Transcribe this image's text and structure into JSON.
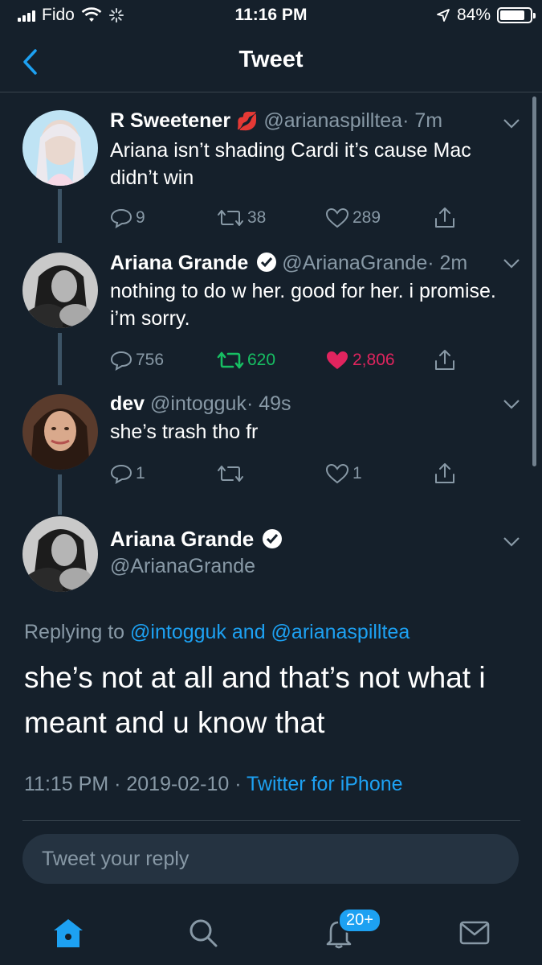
{
  "status_bar": {
    "carrier": "Fido",
    "time": "11:16 PM",
    "battery": "84%",
    "battery_level": 0.84
  },
  "nav": {
    "title": "Tweet"
  },
  "thread": [
    {
      "name": "R Sweetener",
      "emoji": "💋",
      "handle": "@arianaspilltea",
      "time": "· 7m",
      "text": "Ariana isn’t shading Cardi it’s cause Mac didn’t win",
      "replies": "9",
      "retweets": "38",
      "likes": "289"
    },
    {
      "name": "Ariana Grande",
      "handle": "@ArianaGrande",
      "time": "· 2m",
      "text": "nothing to do w her. good for her. i promise. i’m sorry.",
      "replies": "756",
      "retweets": "620",
      "likes": "2,806",
      "retweet_color": "#17bf63",
      "like_color": "#e0245e"
    },
    {
      "name": "dev",
      "handle": "@intogguk",
      "time": "· 49s",
      "text": "she’s trash tho fr",
      "replies": "1",
      "retweets": "",
      "likes": "1"
    }
  ],
  "main_tweet": {
    "name": "Ariana Grande",
    "handle": "@ArianaGrande",
    "replying_prefix": "Replying to ",
    "replying_user1": "@intogguk",
    "replying_and": " and ",
    "replying_user2": "@arianaspilltea",
    "text": "she’s not at all and that’s not what i meant and u know that",
    "timestamp": "11:15 PM · 2019-02-10 · ",
    "source": "Twitter for iPhone"
  },
  "reply_box": {
    "placeholder": "Tweet your reply"
  },
  "tab_bar": {
    "notifications_badge": "20+"
  },
  "colors": {
    "background": "#15202b",
    "accent": "#1da1f2",
    "muted": "#8899a6"
  }
}
